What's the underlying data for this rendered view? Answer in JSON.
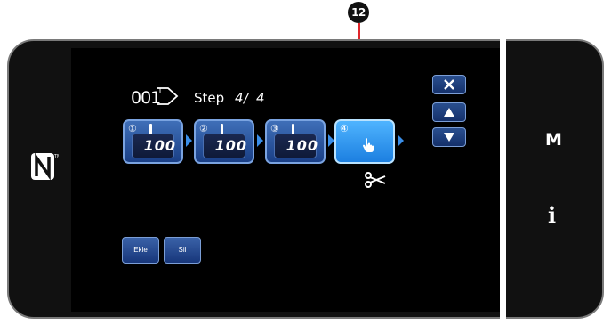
{
  "callout": {
    "label": "12"
  },
  "header": {
    "pattern_number": "001",
    "step_label": "Step",
    "step_current": "4",
    "step_separator": "/",
    "step_total": "4"
  },
  "steps": [
    {
      "number": "①",
      "value": "100",
      "type": "stitch"
    },
    {
      "number": "②",
      "value": "100",
      "type": "stitch"
    },
    {
      "number": "③",
      "value": "100",
      "type": "stitch"
    },
    {
      "number": "④",
      "value": "",
      "type": "touch",
      "selected": true
    }
  ],
  "buttons": {
    "add_label": "Ekle",
    "delete_label": "Sil"
  },
  "side": {
    "menu_label": "M",
    "info_label": "i"
  },
  "icons": {
    "nfc": "nfc-icon",
    "close": "close-icon",
    "up": "arrow-up-icon",
    "down": "arrow-down-icon",
    "scissors": "scissors-icon",
    "hand": "hand-pointer-icon"
  },
  "colors": {
    "selected_step": "#1c7fe0",
    "button_blue": "#17367a",
    "callout_red": "#e0262b"
  }
}
